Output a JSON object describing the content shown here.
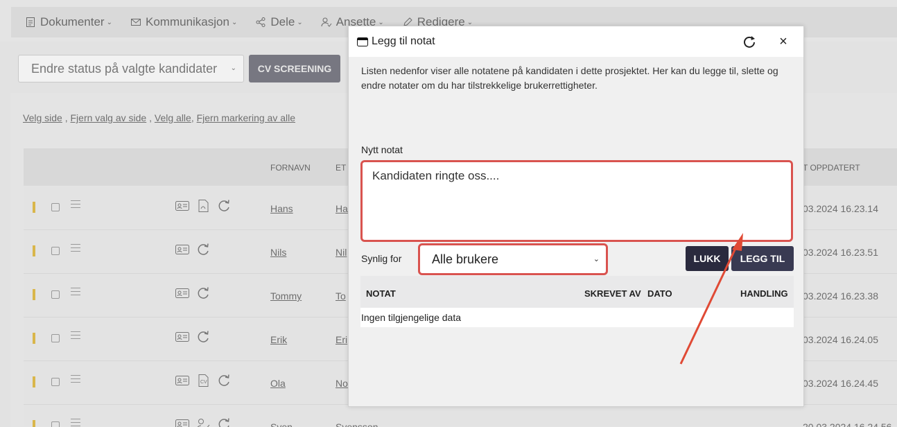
{
  "menubar": {
    "items": [
      {
        "label": "Dokumenter",
        "icon": "document-icon"
      },
      {
        "label": "Kommunikasjon",
        "icon": "mail-icon"
      },
      {
        "label": "Dele",
        "icon": "share-icon"
      },
      {
        "label": "Ansette",
        "icon": "user-check-icon"
      },
      {
        "label": "Redigere",
        "icon": "edit-icon"
      }
    ]
  },
  "toolbar": {
    "status_select": "Endre status på valgte kandidater",
    "cv_button": "CV SCREENING"
  },
  "selection_links": [
    "Velg side",
    "Fjern valg av side",
    "Velg alle",
    "Fjern markering av alle"
  ],
  "table": {
    "headers": {
      "fornavn": "FORNAVN",
      "etternavn": "ET",
      "oppdatert": "T OPPDATERT"
    },
    "rows": [
      {
        "fornavn": "Hans",
        "etternavn": "Ha",
        "oppdatert": "03.2024 16.23.14"
      },
      {
        "fornavn": "Nils",
        "etternavn": "Nil",
        "oppdatert": "03.2024 16.23.51"
      },
      {
        "fornavn": "Tommy",
        "etternavn": "To",
        "oppdatert": "03.2024 16.23.38"
      },
      {
        "fornavn": "Erik",
        "etternavn": "Eri",
        "oppdatert": "03.2024 16.24.05"
      },
      {
        "fornavn": "Ola",
        "etternavn": "No",
        "oppdatert": "03.2024 16.24.45"
      },
      {
        "fornavn": "Sven",
        "etternavn": "Svensson",
        "oppdatert": "20.03.2024 16.24.56"
      }
    ]
  },
  "modal": {
    "title": "Legg til notat",
    "description": "Listen nedenfor viser alle notatene på kandidaten i dette prosjektet. Her kan du legge til, slette og endre notater om du har tilstrekkelige brukerrettigheter.",
    "nytt_notat_label": "Nytt notat",
    "note_value": "Kandidaten ringte oss....",
    "synlig_label": "Synlig for",
    "synlig_value": "Alle brukere",
    "lukk_button": "LUKK",
    "legg_til_button": "LEGG TIL",
    "notes_table": {
      "headers": {
        "notat": "NOTAT",
        "skrevet_av": "SKREVET AV",
        "dato": "DATO",
        "handling": "HANDLING"
      },
      "empty_text": "Ingen tilgjengelige data"
    }
  },
  "colors": {
    "highlight": "#d9534f",
    "primary_button": "#393a52",
    "status_bar": "#d9b64b"
  }
}
